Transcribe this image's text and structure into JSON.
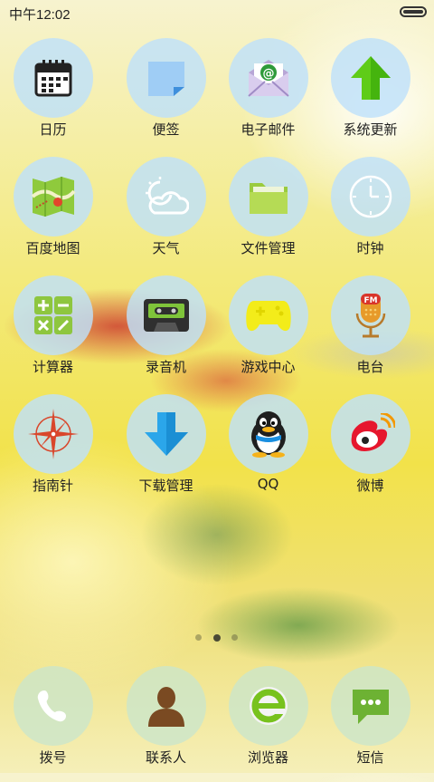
{
  "status": {
    "time": "中午12:02"
  },
  "apps": [
    {
      "label": "日历",
      "icon": "calendar-icon"
    },
    {
      "label": "便签",
      "icon": "note-icon"
    },
    {
      "label": "电子邮件",
      "icon": "email-icon"
    },
    {
      "label": "系统更新",
      "icon": "update-arrow-icon"
    },
    {
      "label": "百度地图",
      "icon": "map-icon"
    },
    {
      "label": "天气",
      "icon": "weather-icon"
    },
    {
      "label": "文件管理",
      "icon": "folder-icon"
    },
    {
      "label": "时钟",
      "icon": "clock-icon"
    },
    {
      "label": "计算器",
      "icon": "calculator-icon"
    },
    {
      "label": "录音机",
      "icon": "cassette-icon"
    },
    {
      "label": "游戏中心",
      "icon": "gamepad-icon"
    },
    {
      "label": "电台",
      "icon": "microphone-icon"
    },
    {
      "label": "指南针",
      "icon": "compass-icon"
    },
    {
      "label": "下载管理",
      "icon": "download-icon"
    },
    {
      "label": "QQ",
      "icon": "qq-penguin-icon"
    },
    {
      "label": "微博",
      "icon": "weibo-icon"
    }
  ],
  "page_indicator": {
    "count": 3,
    "active": 2
  },
  "dock": [
    {
      "label": "拨号",
      "icon": "phone-icon"
    },
    {
      "label": "联系人",
      "icon": "contacts-icon"
    },
    {
      "label": "浏览器",
      "icon": "browser-icon"
    },
    {
      "label": "短信",
      "icon": "sms-icon"
    }
  ],
  "icon_texts": {
    "fm": "FM",
    "at": "@"
  }
}
